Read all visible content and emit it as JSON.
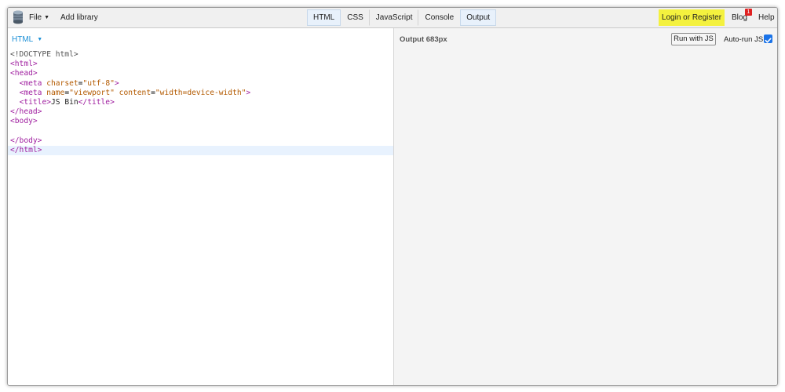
{
  "toolbar": {
    "file_label": "File",
    "add_library_label": "Add library",
    "tabs": [
      {
        "label": "HTML",
        "active": true
      },
      {
        "label": "CSS",
        "active": false
      },
      {
        "label": "JavaScript",
        "active": false
      },
      {
        "label": "Console",
        "active": false
      },
      {
        "label": "Output",
        "active": true
      }
    ],
    "login_label": "Login or Register",
    "blog_label": "Blog",
    "blog_badge": "1",
    "help_label": "Help"
  },
  "editor": {
    "panel_label": "HTML"
  },
  "output": {
    "label": "Output 683px",
    "run_button_label": "Run with JS",
    "autorun_label": "Auto-run JS",
    "autorun_checked": true
  },
  "colors": {
    "accent_blue": "#1b8fd6",
    "login_highlight": "#f4f13e",
    "badge_red": "#e02020",
    "tag_purple": "#a020a0",
    "attr_orange": "#b35a00"
  }
}
